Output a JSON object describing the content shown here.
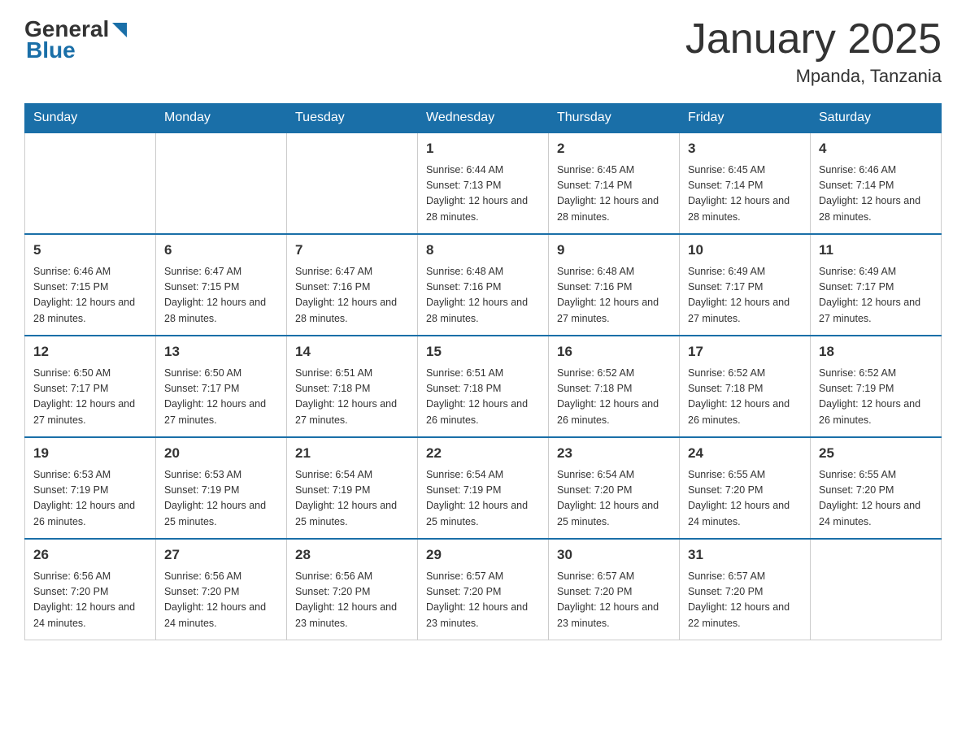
{
  "header": {
    "month_title": "January 2025",
    "location": "Mpanda, Tanzania",
    "logo_general": "General",
    "logo_blue": "Blue"
  },
  "days_of_week": [
    "Sunday",
    "Monday",
    "Tuesday",
    "Wednesday",
    "Thursday",
    "Friday",
    "Saturday"
  ],
  "weeks": [
    [
      {
        "day": "",
        "info": ""
      },
      {
        "day": "",
        "info": ""
      },
      {
        "day": "",
        "info": ""
      },
      {
        "day": "1",
        "info": "Sunrise: 6:44 AM\nSunset: 7:13 PM\nDaylight: 12 hours and 28 minutes."
      },
      {
        "day": "2",
        "info": "Sunrise: 6:45 AM\nSunset: 7:14 PM\nDaylight: 12 hours and 28 minutes."
      },
      {
        "day": "3",
        "info": "Sunrise: 6:45 AM\nSunset: 7:14 PM\nDaylight: 12 hours and 28 minutes."
      },
      {
        "day": "4",
        "info": "Sunrise: 6:46 AM\nSunset: 7:14 PM\nDaylight: 12 hours and 28 minutes."
      }
    ],
    [
      {
        "day": "5",
        "info": "Sunrise: 6:46 AM\nSunset: 7:15 PM\nDaylight: 12 hours and 28 minutes."
      },
      {
        "day": "6",
        "info": "Sunrise: 6:47 AM\nSunset: 7:15 PM\nDaylight: 12 hours and 28 minutes."
      },
      {
        "day": "7",
        "info": "Sunrise: 6:47 AM\nSunset: 7:16 PM\nDaylight: 12 hours and 28 minutes."
      },
      {
        "day": "8",
        "info": "Sunrise: 6:48 AM\nSunset: 7:16 PM\nDaylight: 12 hours and 28 minutes."
      },
      {
        "day": "9",
        "info": "Sunrise: 6:48 AM\nSunset: 7:16 PM\nDaylight: 12 hours and 27 minutes."
      },
      {
        "day": "10",
        "info": "Sunrise: 6:49 AM\nSunset: 7:17 PM\nDaylight: 12 hours and 27 minutes."
      },
      {
        "day": "11",
        "info": "Sunrise: 6:49 AM\nSunset: 7:17 PM\nDaylight: 12 hours and 27 minutes."
      }
    ],
    [
      {
        "day": "12",
        "info": "Sunrise: 6:50 AM\nSunset: 7:17 PM\nDaylight: 12 hours and 27 minutes."
      },
      {
        "day": "13",
        "info": "Sunrise: 6:50 AM\nSunset: 7:17 PM\nDaylight: 12 hours and 27 minutes."
      },
      {
        "day": "14",
        "info": "Sunrise: 6:51 AM\nSunset: 7:18 PM\nDaylight: 12 hours and 27 minutes."
      },
      {
        "day": "15",
        "info": "Sunrise: 6:51 AM\nSunset: 7:18 PM\nDaylight: 12 hours and 26 minutes."
      },
      {
        "day": "16",
        "info": "Sunrise: 6:52 AM\nSunset: 7:18 PM\nDaylight: 12 hours and 26 minutes."
      },
      {
        "day": "17",
        "info": "Sunrise: 6:52 AM\nSunset: 7:18 PM\nDaylight: 12 hours and 26 minutes."
      },
      {
        "day": "18",
        "info": "Sunrise: 6:52 AM\nSunset: 7:19 PM\nDaylight: 12 hours and 26 minutes."
      }
    ],
    [
      {
        "day": "19",
        "info": "Sunrise: 6:53 AM\nSunset: 7:19 PM\nDaylight: 12 hours and 26 minutes."
      },
      {
        "day": "20",
        "info": "Sunrise: 6:53 AM\nSunset: 7:19 PM\nDaylight: 12 hours and 25 minutes."
      },
      {
        "day": "21",
        "info": "Sunrise: 6:54 AM\nSunset: 7:19 PM\nDaylight: 12 hours and 25 minutes."
      },
      {
        "day": "22",
        "info": "Sunrise: 6:54 AM\nSunset: 7:19 PM\nDaylight: 12 hours and 25 minutes."
      },
      {
        "day": "23",
        "info": "Sunrise: 6:54 AM\nSunset: 7:20 PM\nDaylight: 12 hours and 25 minutes."
      },
      {
        "day": "24",
        "info": "Sunrise: 6:55 AM\nSunset: 7:20 PM\nDaylight: 12 hours and 24 minutes."
      },
      {
        "day": "25",
        "info": "Sunrise: 6:55 AM\nSunset: 7:20 PM\nDaylight: 12 hours and 24 minutes."
      }
    ],
    [
      {
        "day": "26",
        "info": "Sunrise: 6:56 AM\nSunset: 7:20 PM\nDaylight: 12 hours and 24 minutes."
      },
      {
        "day": "27",
        "info": "Sunrise: 6:56 AM\nSunset: 7:20 PM\nDaylight: 12 hours and 24 minutes."
      },
      {
        "day": "28",
        "info": "Sunrise: 6:56 AM\nSunset: 7:20 PM\nDaylight: 12 hours and 23 minutes."
      },
      {
        "day": "29",
        "info": "Sunrise: 6:57 AM\nSunset: 7:20 PM\nDaylight: 12 hours and 23 minutes."
      },
      {
        "day": "30",
        "info": "Sunrise: 6:57 AM\nSunset: 7:20 PM\nDaylight: 12 hours and 23 minutes."
      },
      {
        "day": "31",
        "info": "Sunrise: 6:57 AM\nSunset: 7:20 PM\nDaylight: 12 hours and 22 minutes."
      },
      {
        "day": "",
        "info": ""
      }
    ]
  ]
}
